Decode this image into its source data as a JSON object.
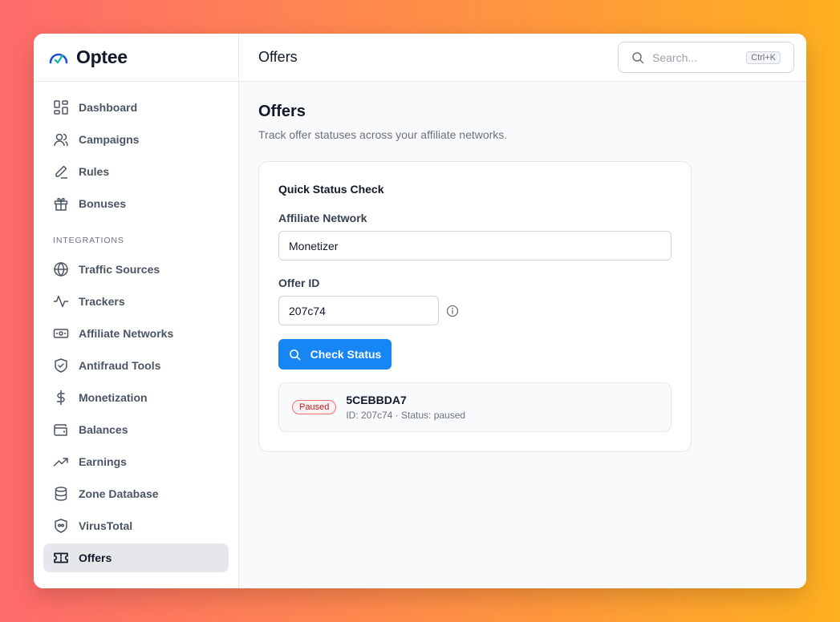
{
  "brand": {
    "name": "Optee",
    "logo_icon": "gauge-icon",
    "accent": "#1686f5"
  },
  "sidebar": {
    "items": [
      {
        "label": "Dashboard",
        "icon": "dashboard-icon"
      },
      {
        "label": "Campaigns",
        "icon": "users-icon"
      },
      {
        "label": "Rules",
        "icon": "pen-icon"
      },
      {
        "label": "Bonuses",
        "icon": "gift-icon"
      }
    ],
    "section_label": "INTEGRATIONS",
    "integrations": [
      {
        "label": "Traffic Sources",
        "icon": "globe-icon"
      },
      {
        "label": "Trackers",
        "icon": "activity-icon"
      },
      {
        "label": "Affiliate Networks",
        "icon": "banknote-icon"
      },
      {
        "label": "Antifraud Tools",
        "icon": "shield-check-icon"
      },
      {
        "label": "Monetization",
        "icon": "dollar-icon"
      },
      {
        "label": "Balances",
        "icon": "wallet-icon"
      },
      {
        "label": "Earnings",
        "icon": "trending-up-icon"
      },
      {
        "label": "Zone Database",
        "icon": "database-icon"
      },
      {
        "label": "VirusTotal",
        "icon": "shield-virus-icon"
      },
      {
        "label": "Offers",
        "icon": "ticket-icon",
        "active": true
      }
    ]
  },
  "topbar": {
    "title": "Offers",
    "search_placeholder": "Search...",
    "search_shortcut": "Ctrl+K"
  },
  "page": {
    "title": "Offers",
    "subtitle": "Track offer statuses across your affiliate networks."
  },
  "card": {
    "title": "Quick Status Check",
    "network_label": "Affiliate Network",
    "network_value": "Monetizer",
    "offer_label": "Offer ID",
    "offer_value": "207c74",
    "button_label": "Check Status"
  },
  "result": {
    "badge": "Paused",
    "badge_color": "#b91c1c",
    "name": "5CEBBDA7",
    "meta": "ID: 207c74 · Status: paused"
  }
}
